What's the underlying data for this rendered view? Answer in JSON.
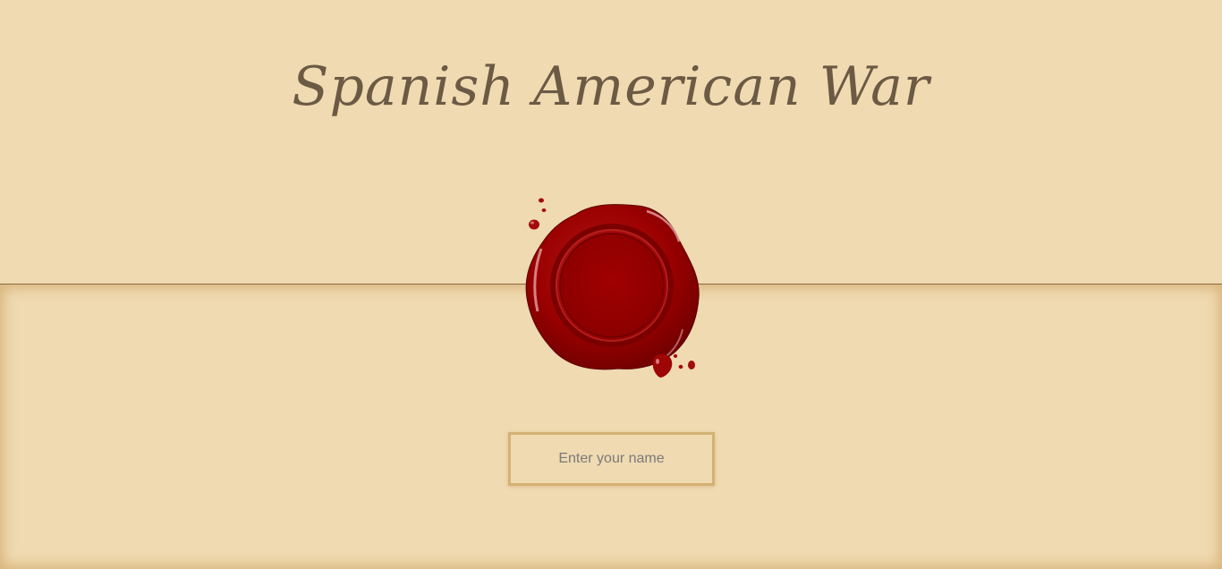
{
  "header": {
    "title": "Spanish American War"
  },
  "seal": {
    "icon": "wax-seal-icon",
    "color": "#9a0000"
  },
  "name_form": {
    "placeholder": "Enter your name",
    "value": ""
  },
  "colors": {
    "background": "#f0dab1",
    "title": "#6b5a44",
    "input_border": "#d2b173",
    "envelope_line": "#8b6a3a"
  }
}
